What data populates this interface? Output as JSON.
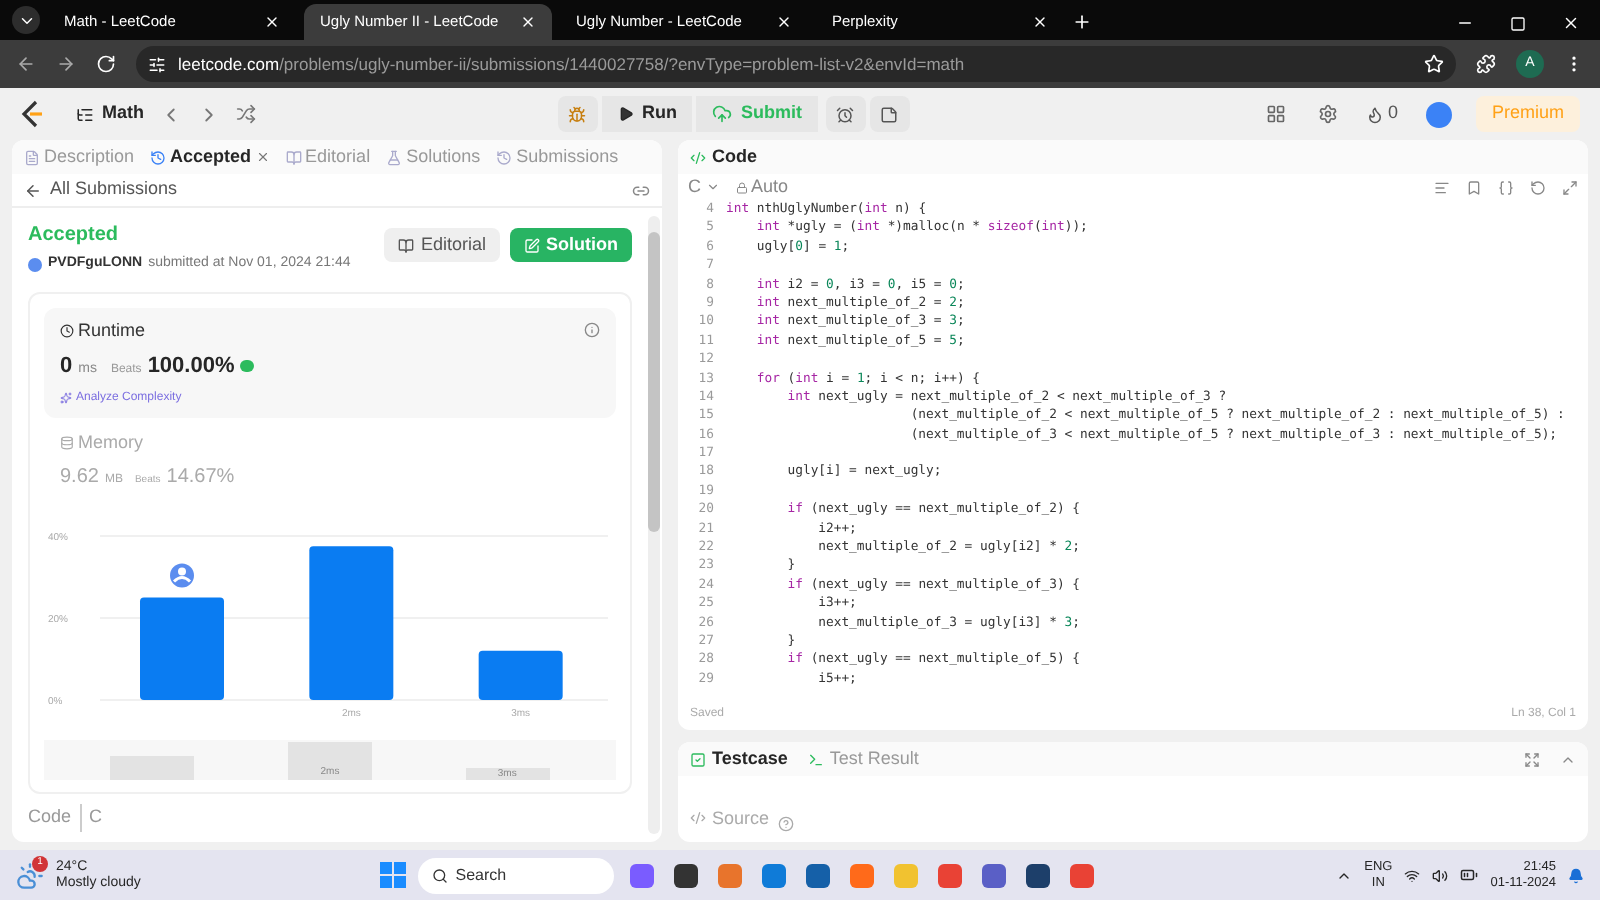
{
  "browser": {
    "tabs": [
      {
        "title": "Math - LeetCode",
        "selected": false
      },
      {
        "title": "Ugly Number II - LeetCode",
        "selected": true
      },
      {
        "title": "Ugly Number - LeetCode",
        "selected": false
      },
      {
        "title": "Perplexity",
        "selected": false
      }
    ],
    "url": {
      "host": "leetcode.com",
      "path": "/problems/ugly-number-ii/submissions/1440027758/?envType=problem-list-v2&envId=math"
    },
    "profile_initial": "A"
  },
  "nav": {
    "list": "Math",
    "run": "Run",
    "submit": "Submit",
    "streak": "0",
    "premium": "Premium"
  },
  "left_tabs": [
    {
      "label": "Description",
      "selected": false,
      "closable": false
    },
    {
      "label": "Accepted",
      "selected": true,
      "closable": true
    },
    {
      "label": "Editorial",
      "selected": false,
      "closable": false
    },
    {
      "label": "Solutions",
      "selected": false,
      "closable": false
    },
    {
      "label": "Submissions",
      "selected": false,
      "closable": false
    }
  ],
  "submission": {
    "back": "All Submissions",
    "status": "Accepted",
    "user": "PVDFguLONN",
    "submitted": "submitted at Nov 01, 2024 21:44",
    "editorial": "Editorial",
    "solution": "Solution",
    "runtime": {
      "title": "Runtime",
      "value": "0",
      "unit": "ms",
      "beats_label": "Beats",
      "beats": "100.00%",
      "analyze": "Analyze Complexity"
    },
    "memory": {
      "title": "Memory",
      "value": "9.62",
      "unit": "MB",
      "beats_label": "Beats",
      "beats": "14.67%"
    },
    "chart_data": {
      "type": "bar",
      "categories": [
        null,
        "2ms",
        "3ms"
      ],
      "series": [
        {
          "color": "#0a7cf2",
          "values": [
            25,
            37.5,
            12
          ]
        }
      ],
      "ylim": [
        0,
        40
      ],
      "yticks": [
        {
          "value": 0,
          "label": "0%"
        },
        {
          "value": 20,
          "label": "20%"
        },
        {
          "value": 40,
          "label": "40%"
        }
      ]
    },
    "overview_labels": [
      "2ms",
      "3ms"
    ],
    "code_label": "Code",
    "language": "C"
  },
  "editor": {
    "title": "Code",
    "language": "C",
    "mode": "Auto",
    "lines": [
      {
        "n": "4",
        "text": "int nthUglyNumber(int n) {"
      },
      {
        "n": "5",
        "text": "    int *ugly = (int *)malloc(n * sizeof(int));"
      },
      {
        "n": "6",
        "text": "    ugly[0] = 1;"
      },
      {
        "n": "7"
      },
      {
        "n": "8",
        "text": "    int i2 = 0, i3 = 0, i5 = 0;"
      },
      {
        "n": "9",
        "text": "    int next_multiple_of_2 = 2;"
      },
      {
        "n": "10",
        "text": "    int next_multiple_of_3 = 3;"
      },
      {
        "n": "11",
        "text": "    int next_multiple_of_5 = 5;"
      },
      {
        "n": "12"
      },
      {
        "n": "13",
        "text": "    for (int i = 1; i < n; i++) {"
      },
      {
        "n": "14",
        "text": "        int next_ugly = next_multiple_of_2 < next_multiple_of_3 ?"
      },
      {
        "n": "15",
        "text": "                        (next_multiple_of_2 < next_multiple_of_5 ? next_multiple_of_2 : next_multiple_of_5) :"
      },
      {
        "n": "16",
        "text": "                        (next_multiple_of_3 < next_multiple_of_5 ? next_multiple_of_3 : next_multiple_of_5);"
      },
      {
        "n": "17"
      },
      {
        "n": "18",
        "text": "        ugly[i] = next_ugly;"
      },
      {
        "n": "19"
      },
      {
        "n": "20",
        "text": "        if (next_ugly == next_multiple_of_2) {"
      },
      {
        "n": "21",
        "text": "            i2++;"
      },
      {
        "n": "22",
        "text": "            next_multiple_of_2 = ugly[i2] * 2;"
      },
      {
        "n": "23",
        "text": "        }"
      },
      {
        "n": "24",
        "text": "        if (next_ugly == next_multiple_of_3) {"
      },
      {
        "n": "25",
        "text": "            i3++;"
      },
      {
        "n": "26",
        "text": "            next_multiple_of_3 = ugly[i3] * 3;"
      },
      {
        "n": "27",
        "text": "        }"
      },
      {
        "n": "28",
        "text": "        if (next_ugly == next_multiple_of_5) {"
      },
      {
        "n": "29",
        "text": "            i5++;"
      }
    ],
    "saved": "Saved",
    "cursor": "Ln 38, Col 1"
  },
  "console": {
    "tabs": [
      {
        "label": "Testcase",
        "selected": true
      },
      {
        "label": "Test Result",
        "selected": false
      }
    ],
    "source": "Source"
  },
  "taskbar": {
    "weather": {
      "badge": "1",
      "temp": "24°C",
      "desc": "Mostly cloudy"
    },
    "search": "Search",
    "lang": "ENG",
    "region": "IN",
    "time": "21:45",
    "date": "01-11-2024"
  }
}
